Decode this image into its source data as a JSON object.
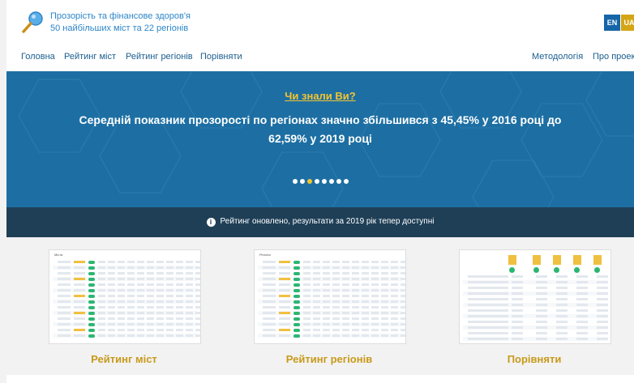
{
  "header": {
    "title_line1": "Прозорість та фінансове здоров'я",
    "title_line2": "50 найбільших міст та 22 регіонів",
    "lang_en": "EN",
    "lang_ua": "UA",
    "logo_icon": "magnifier-icon"
  },
  "nav": {
    "items": [
      "Головна",
      "Рейтинг міст",
      "Рейтинг регіонів",
      "Порівняти"
    ],
    "right_items": [
      "Методологія",
      "Про проект"
    ]
  },
  "hero": {
    "title": "Чи знали Ви?",
    "text": "Середній показник прозорості по регіонах значно збільшився з 45,45% у 2016 році до 62,59% у 2019 році",
    "slides_total": 8,
    "active_slide": 3
  },
  "notice": {
    "icon": "info-icon",
    "text": "Рейтинг оновлено, результати за 2019 рік тепер доступні"
  },
  "cards": [
    {
      "label": "Рейтинг міст",
      "thumb_title": "Міста"
    },
    {
      "label": "Рейтинг регіонів",
      "thumb_title": "Регіони"
    },
    {
      "label": "Порівняти",
      "thumb_title": ""
    }
  ],
  "colors": {
    "brand_blue": "#2d86c9",
    "nav_text": "#1a5e8e",
    "hero_bg": "#1d6fa3",
    "accent_yellow": "#f4c430",
    "notice_bg": "#1f3f57",
    "card_label": "#c89a1a"
  }
}
